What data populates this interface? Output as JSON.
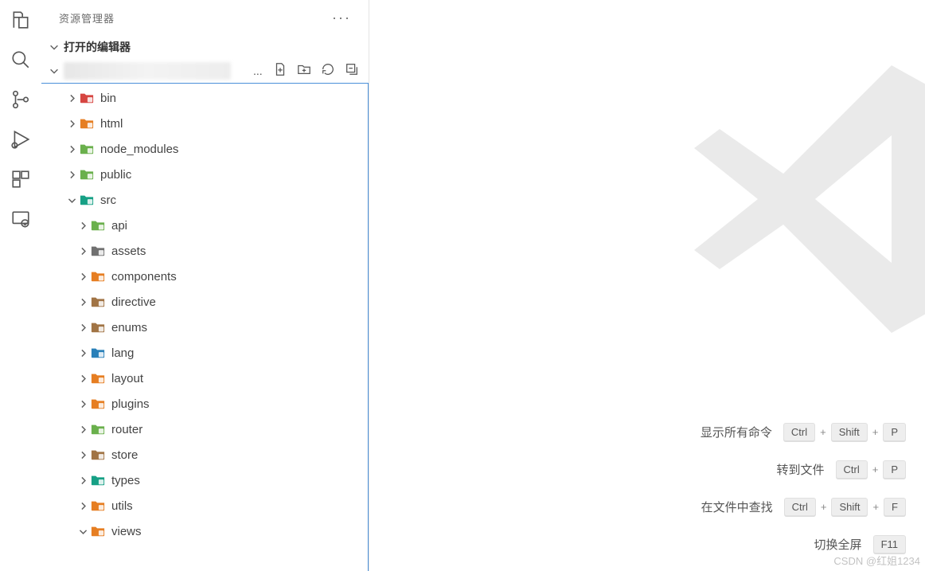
{
  "sidebar": {
    "title": "资源管理器",
    "openEditors": "打开的编辑器",
    "projectEllipsis": "...",
    "actions": {
      "newFile": "新建文件",
      "newFolder": "新建文件夹",
      "refresh": "刷新",
      "collapse": "折叠"
    }
  },
  "tree": [
    {
      "label": "bin",
      "level": 1,
      "chev": "r",
      "icon": "red"
    },
    {
      "label": "html",
      "level": 1,
      "chev": "r",
      "icon": "orange"
    },
    {
      "label": "node_modules",
      "level": 1,
      "chev": "r",
      "icon": "green"
    },
    {
      "label": "public",
      "level": 1,
      "chev": "r",
      "icon": "green"
    },
    {
      "label": "src",
      "level": 1,
      "chev": "d",
      "icon": "teal"
    },
    {
      "label": "api",
      "level": 2,
      "chev": "r",
      "icon": "green"
    },
    {
      "label": "assets",
      "level": 2,
      "chev": "r",
      "icon": "gray"
    },
    {
      "label": "components",
      "level": 2,
      "chev": "r",
      "icon": "orange"
    },
    {
      "label": "directive",
      "level": 2,
      "chev": "r",
      "icon": "brown"
    },
    {
      "label": "enums",
      "level": 2,
      "chev": "r",
      "icon": "brown"
    },
    {
      "label": "lang",
      "level": 2,
      "chev": "r",
      "icon": "blue"
    },
    {
      "label": "layout",
      "level": 2,
      "chev": "r",
      "icon": "orange"
    },
    {
      "label": "plugins",
      "level": 2,
      "chev": "r",
      "icon": "orange"
    },
    {
      "label": "router",
      "level": 2,
      "chev": "r",
      "icon": "green"
    },
    {
      "label": "store",
      "level": 2,
      "chev": "r",
      "icon": "brown"
    },
    {
      "label": "types",
      "level": 2,
      "chev": "r",
      "icon": "teal"
    },
    {
      "label": "utils",
      "level": 2,
      "chev": "r",
      "icon": "orange"
    },
    {
      "label": "views",
      "level": 2,
      "chev": "d",
      "icon": "orange"
    }
  ],
  "commands": [
    {
      "label": "显示所有命令",
      "keys": [
        "Ctrl",
        "Shift",
        "P"
      ]
    },
    {
      "label": "转到文件",
      "keys": [
        "Ctrl",
        "P"
      ]
    },
    {
      "label": "在文件中查找",
      "keys": [
        "Ctrl",
        "Shift",
        "F"
      ]
    },
    {
      "label": "切换全屏",
      "keys": [
        "F11"
      ]
    }
  ],
  "plusSign": "+",
  "watermark": "CSDN @红姐1234",
  "iconColors": {
    "red": "#d64541",
    "orange": "#e67e22",
    "green": "#6ab04c",
    "teal": "#16a085",
    "gray": "#707070",
    "brown": "#a17445",
    "blue": "#2980b9"
  }
}
